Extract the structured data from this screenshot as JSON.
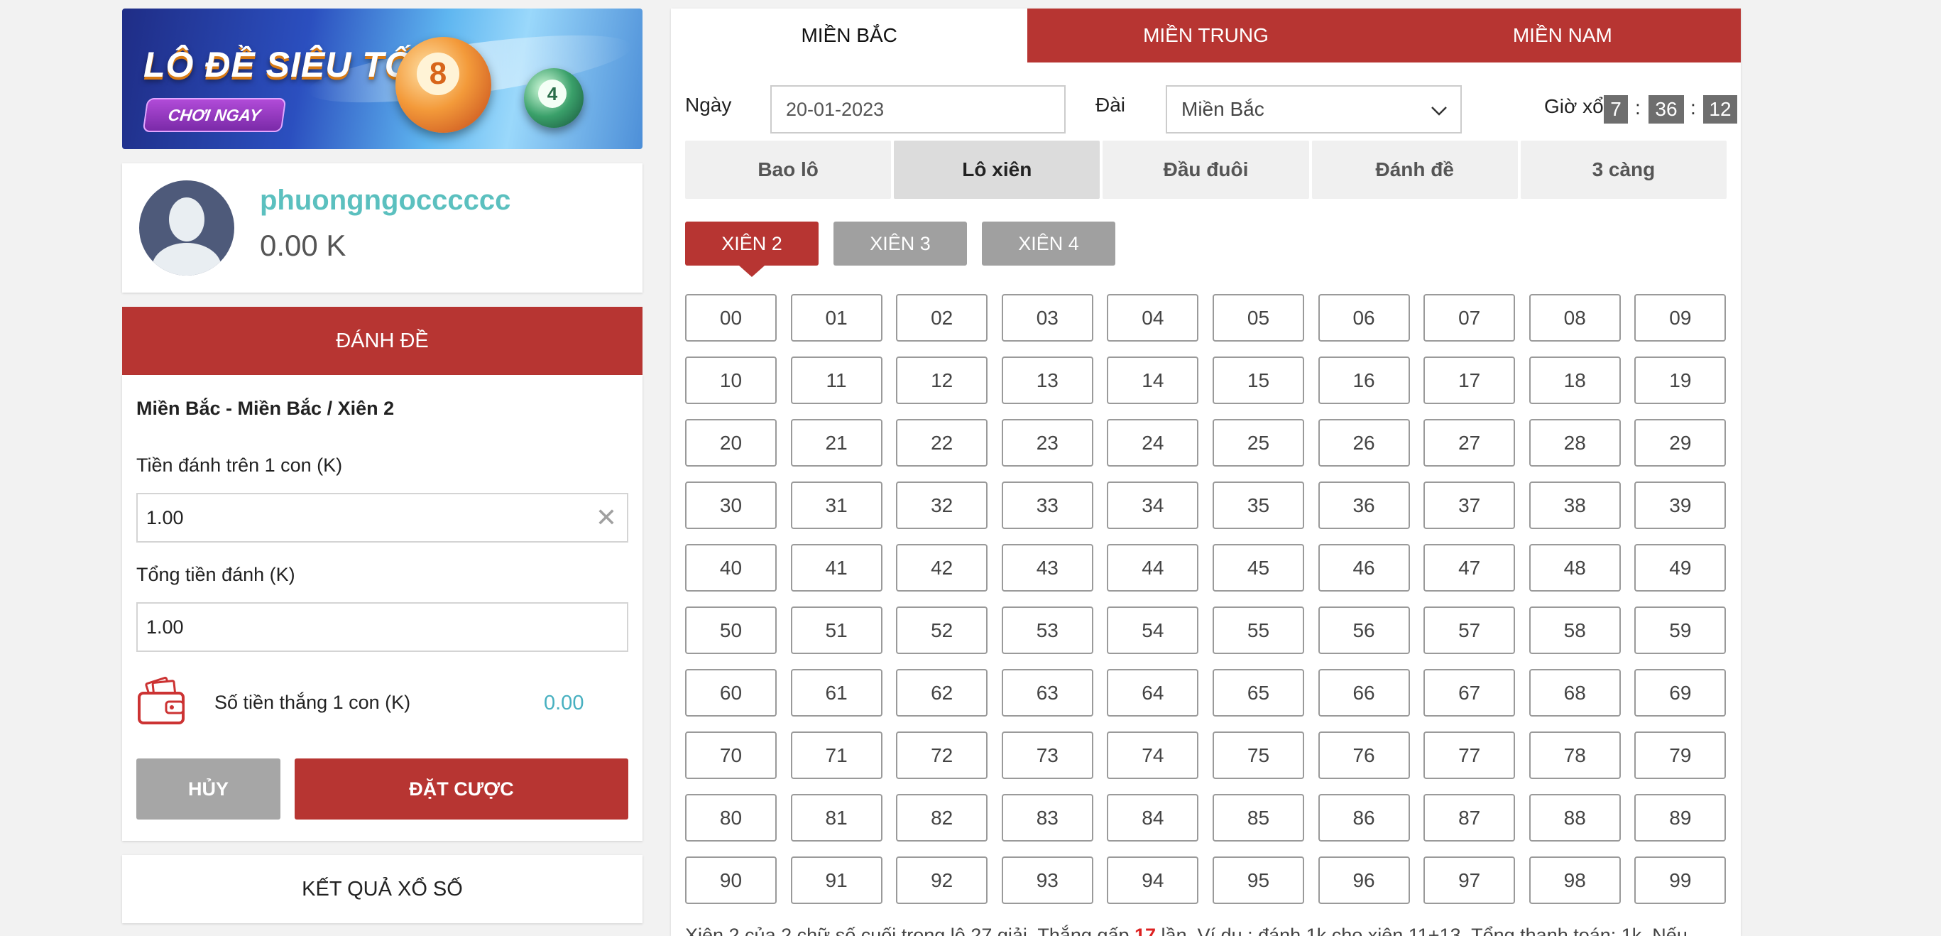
{
  "banner": {
    "title": "LÔ ĐỀ SIÊU TỐC",
    "cta": "CHƠI NGAY",
    "ball_big_number": "8",
    "ball_small_number": "4"
  },
  "profile": {
    "username": "phuongngocccccc",
    "balance": "0.00 K"
  },
  "bet_panel": {
    "header": "ĐÁNH ĐỀ",
    "path": "Miền Bắc - Miền Bắc / Xiên 2",
    "stake_label": "Tiền đánh trên 1 con (K)",
    "stake_value": "1.00",
    "total_label": "Tổng tiền đánh (K)",
    "total_value": "1.00",
    "win_label": "Số tiền thắng 1 con (K)",
    "win_value": "0.00",
    "cancel_label": "HỦY",
    "bet_label": "ĐẶT CƯỢC"
  },
  "results_link": "KẾT QUẢ XỔ SỐ",
  "region_tabs": [
    {
      "label": "MIỀN BẮC",
      "active": true
    },
    {
      "label": "MIỀN TRUNG",
      "active": false
    },
    {
      "label": "MIỀN NAM",
      "active": false
    }
  ],
  "filters": {
    "date_label": "Ngày",
    "date_value": "20-01-2023",
    "dai_label": "Đài",
    "dai_value": "Miền Bắc",
    "time_label": "Giờ xổ",
    "time_h": "7",
    "time_m": "36",
    "time_s": "12"
  },
  "game_tabs": [
    {
      "label": "Bao lô",
      "active": false
    },
    {
      "label": "Lô xiên",
      "active": true
    },
    {
      "label": "Đầu đuôi",
      "active": false
    },
    {
      "label": "Đánh đề",
      "active": false
    },
    {
      "label": "3 càng",
      "active": false
    }
  ],
  "xien_tabs": [
    {
      "label": "XIÊN 2",
      "active": true
    },
    {
      "label": "XIÊN 3",
      "active": false
    },
    {
      "label": "XIÊN 4",
      "active": false
    }
  ],
  "numbers": [
    "00",
    "01",
    "02",
    "03",
    "04",
    "05",
    "06",
    "07",
    "08",
    "09",
    "10",
    "11",
    "12",
    "13",
    "14",
    "15",
    "16",
    "17",
    "18",
    "19",
    "20",
    "21",
    "22",
    "23",
    "24",
    "25",
    "26",
    "27",
    "28",
    "29",
    "30",
    "31",
    "32",
    "33",
    "34",
    "35",
    "36",
    "37",
    "38",
    "39",
    "40",
    "41",
    "42",
    "43",
    "44",
    "45",
    "46",
    "47",
    "48",
    "49",
    "50",
    "51",
    "52",
    "53",
    "54",
    "55",
    "56",
    "57",
    "58",
    "59",
    "60",
    "61",
    "62",
    "63",
    "64",
    "65",
    "66",
    "67",
    "68",
    "69",
    "70",
    "71",
    "72",
    "73",
    "74",
    "75",
    "76",
    "77",
    "78",
    "79",
    "80",
    "81",
    "82",
    "83",
    "84",
    "85",
    "86",
    "87",
    "88",
    "89",
    "90",
    "91",
    "92",
    "93",
    "94",
    "95",
    "96",
    "97",
    "98",
    "99"
  ],
  "note": {
    "before": "Xiên 2 của 2 chữ số cuối trong lô 27 giải. Thắng gấp ",
    "highlight": "17",
    "after": " lần. Ví dụ : đánh 1k cho xiên 11+13, Tổng thanh toán: 1k. Nếu"
  },
  "colors": {
    "primary_red": "#b73532",
    "username_teal": "#5bc0bf",
    "win_value_teal": "#47b0c0",
    "inactive_gray": "#a0a0a0"
  }
}
